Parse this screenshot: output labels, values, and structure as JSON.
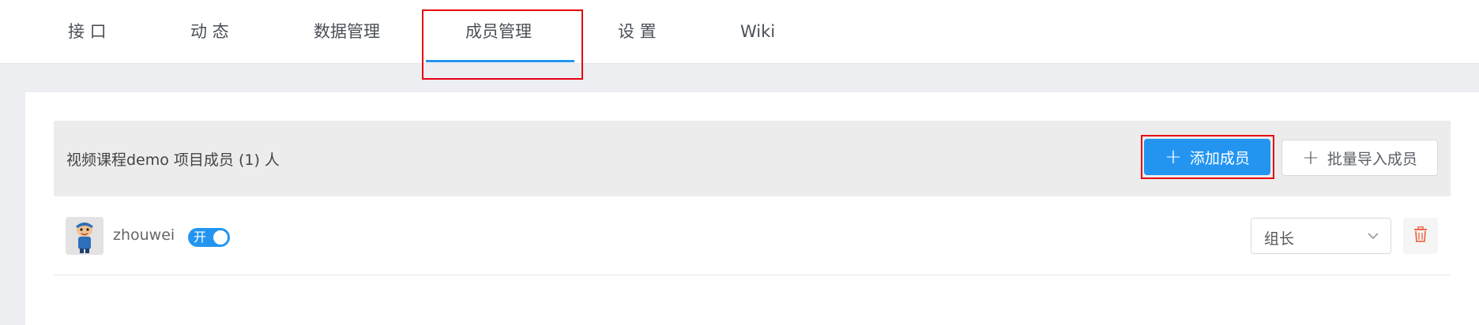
{
  "nav": {
    "tabs": [
      {
        "label": "接 口"
      },
      {
        "label": "动 态"
      },
      {
        "label": "数据管理"
      },
      {
        "label": "成员管理"
      },
      {
        "label": "设 置"
      },
      {
        "label": "Wiki"
      }
    ],
    "active_tab": "成员管理"
  },
  "members": {
    "title": "视频课程demo 项目成员 (1) 人",
    "add_button_label": "添加成员",
    "batch_import_label": "批量导入成员",
    "list": [
      {
        "name": "zhouwei",
        "switch_label": "开",
        "switch_on": true,
        "role": "组长"
      }
    ]
  },
  "colors": {
    "accent": "#2395f1",
    "highlight_box": "#e60012",
    "delete_icon": "#f06a4b"
  },
  "icons": {
    "add": "plus-icon",
    "dropdown": "chevron-down-icon",
    "delete": "trash-icon",
    "avatar": "user-avatar-icon"
  }
}
